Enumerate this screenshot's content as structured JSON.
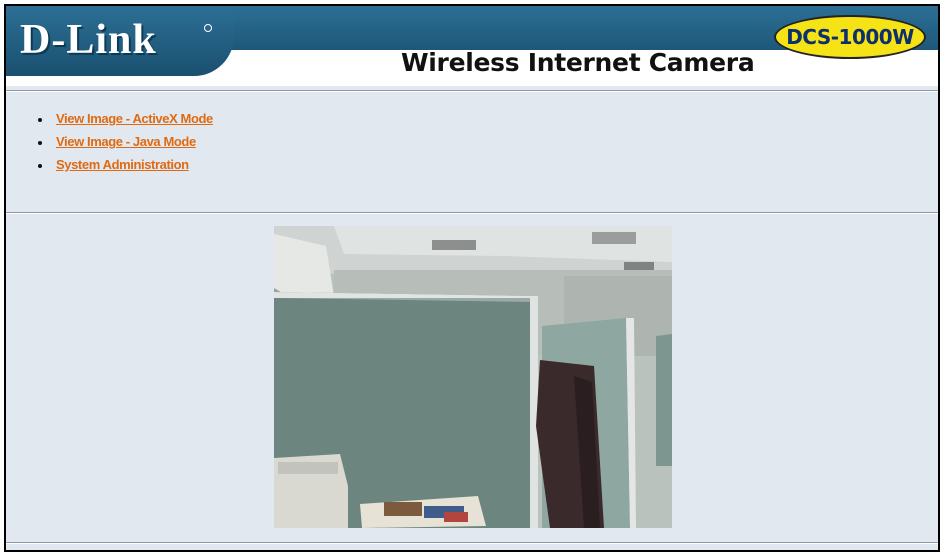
{
  "header": {
    "brand": "D-Link",
    "product_title": "Wireless Internet Camera",
    "model": "DCS-1000W"
  },
  "nav": {
    "items": [
      {
        "label": "View Image - ActiveX Mode"
      },
      {
        "label": "View Image - Java Mode"
      },
      {
        "label": "System Administration"
      }
    ]
  },
  "colors": {
    "header_blue": "#1e5878",
    "link_orange": "#e06a12",
    "page_background": "#e2e8f0",
    "badge_yellow": "#f6e315"
  }
}
